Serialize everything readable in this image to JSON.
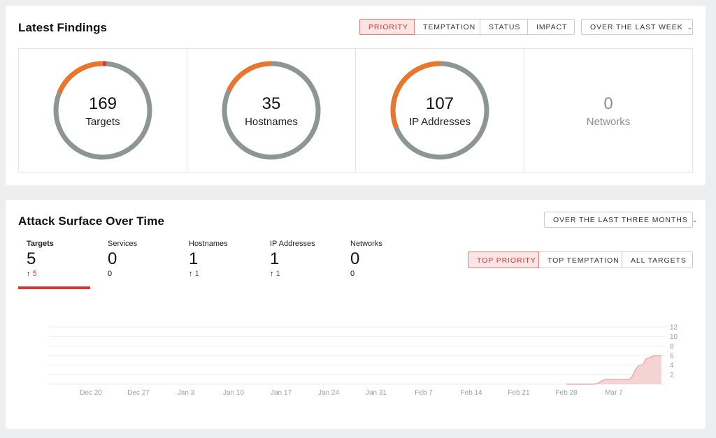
{
  "findings": {
    "title": "Latest Findings",
    "tabs": [
      "PRIORITY",
      "TEMPTATION",
      "STATUS",
      "IMPACT"
    ],
    "active_tab": "PRIORITY",
    "range": "OVER THE LAST WEEK",
    "tiles": [
      {
        "value": "169",
        "label": "Targets",
        "orange_fraction": 0.19,
        "red_fraction": 0.012
      },
      {
        "value": "35",
        "label": "Hostnames",
        "orange_fraction": 0.18,
        "red_fraction": 0
      },
      {
        "value": "107",
        "label": "IP Addresses",
        "orange_fraction": 0.31,
        "red_fraction": 0
      },
      {
        "value": "0",
        "label": "Networks",
        "orange_fraction": 0,
        "red_fraction": 0
      }
    ]
  },
  "surface": {
    "title": "Attack Surface Over Time",
    "range": "OVER THE LAST THREE MONTHS",
    "metrics": [
      {
        "label": "Targets",
        "value": "5",
        "delta": "5",
        "arrow": "↑"
      },
      {
        "label": "Services",
        "value": "0",
        "delta": "0",
        "arrow": ""
      },
      {
        "label": "Hostnames",
        "value": "1",
        "delta": "1",
        "arrow": "↑"
      },
      {
        "label": "IP Addresses",
        "value": "1",
        "delta": "1",
        "arrow": "↑"
      },
      {
        "label": "Networks",
        "value": "0",
        "delta": "0",
        "arrow": ""
      }
    ],
    "target_tabs": [
      "TOP PRIORITY",
      "TOP TEMPTATION",
      "ALL TARGETS"
    ],
    "active_target_tab": "TOP PRIORITY"
  },
  "colors": {
    "accent": "#d23a3a",
    "orange": "#e8762d",
    "ring": "#8e9694",
    "area_fill": "#f5d3d3",
    "area_line": "#e8a0a0"
  },
  "chart_data": {
    "type": "area",
    "x_ticks": [
      "Dec 20",
      "Dec 27",
      "Jan 3",
      "Jan 10",
      "Jan 17",
      "Jan 24",
      "Jan 31",
      "Feb 7",
      "Feb 14",
      "Feb 21",
      "Feb 28",
      "Mar 7"
    ],
    "y_ticks": [
      2,
      4,
      6,
      8,
      10,
      12
    ],
    "ylim": [
      0,
      12
    ],
    "series": [
      {
        "points": [
          {
            "x": "Feb 28",
            "y": 0
          },
          {
            "x": "Mar 4",
            "y": 0
          },
          {
            "x": "Mar 6",
            "y": 1
          },
          {
            "x": "Mar 9",
            "y": 1
          },
          {
            "x": "Mar 11",
            "y": 4
          },
          {
            "x": "Mar 12",
            "y": 5.5
          },
          {
            "x": "Mar 13",
            "y": 6
          },
          {
            "x": "Mar 14",
            "y": 6
          }
        ]
      }
    ]
  }
}
